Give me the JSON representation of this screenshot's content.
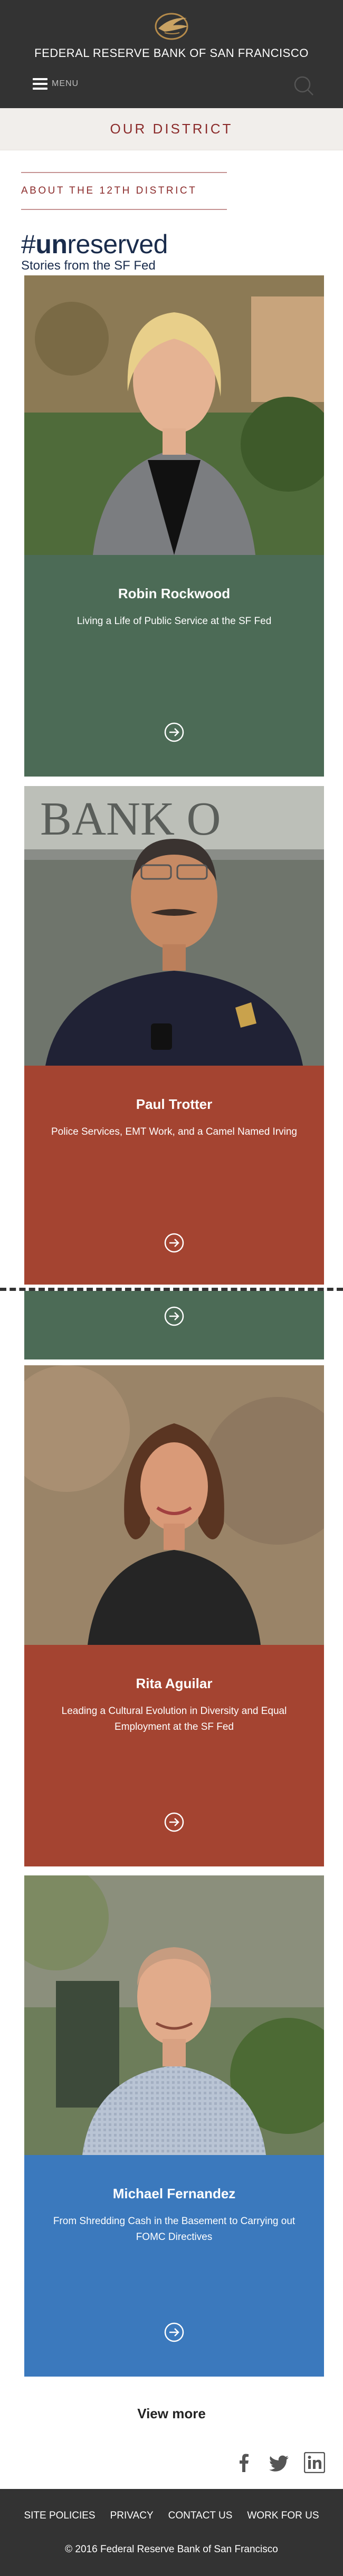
{
  "header": {
    "site_title": "FEDERAL RESERVE BANK OF SAN FRANCISCO",
    "menu_label": "MENU"
  },
  "section": {
    "banner": "OUR DISTRICT",
    "about": "ABOUT THE 12TH DISTRICT"
  },
  "unreserved": {
    "title_prefix": "#",
    "title_bold": "un",
    "title_rest": "reserved",
    "subtitle": "Stories from the SF Fed"
  },
  "stories": [
    {
      "name": "Robin Rockwood",
      "blurb": "Living a Life of Public Service at the SF Fed",
      "color": "#4c6b56"
    },
    {
      "name": "Paul Trotter",
      "blurb": "Police Services, EMT Work, and a Camel Named Irving",
      "color": "#a44431"
    },
    {
      "name": "Rita Aguilar",
      "blurb": "Leading a Cultural Evolution in Diversity and Equal Employment at the SF Fed",
      "color": "#a44431"
    },
    {
      "name": "Michael Fernandez",
      "blurb": "From Shredding Cash in the Basement to Carrying out FOMC Directives",
      "color": "#3b79bd"
    }
  ],
  "view_more": "View more",
  "social": [
    "facebook-icon",
    "twitter-icon",
    "linkedin-icon"
  ],
  "footer": {
    "links": [
      "SITE POLICIES",
      "PRIVACY",
      "CONTACT US",
      "WORK FOR US"
    ],
    "copyright": "© 2016 Federal Reserve Bank of San Francisco"
  }
}
